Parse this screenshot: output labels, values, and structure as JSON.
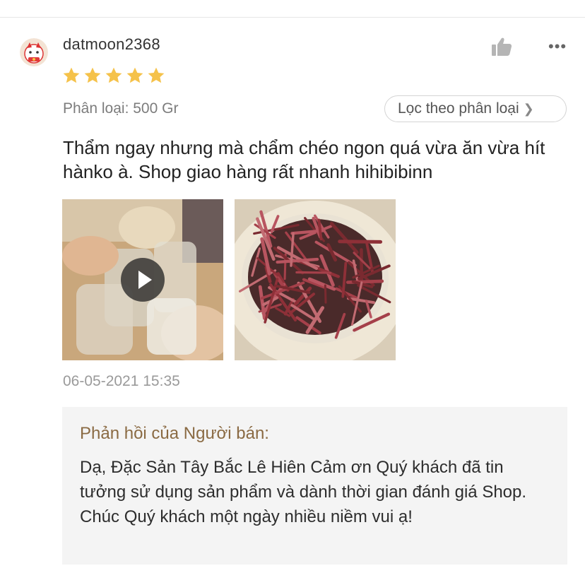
{
  "review": {
    "username": "datmoon2368",
    "rating": 5,
    "variant": "Phân loại: 500 Gr",
    "filter_button": "Lọc theo phân loại",
    "text": "Thẩm ngay nhưng mà chẩm chéo ngon quá vừa ăn vừa hít hànko à. Shop giao hàng rất nhanh hihibibinn",
    "timestamp": "06-05-2021 15:35",
    "media": [
      {
        "type": "video",
        "icon": "play-icon"
      },
      {
        "type": "photo"
      }
    ]
  },
  "seller_reply": {
    "title": "Phản hồi của Người bán:",
    "text": "Dạ, Đặc Sản Tây Bắc Lê Hiên Cảm ơn Quý khách đã tin tưởng sử dụng sản phẩm và dành thời gian đánh giá Shop. Chúc Quý khách một ngày nhiều niềm vui ạ!"
  },
  "colors": {
    "star": "#f5c24a",
    "seller_title": "#8a6a43",
    "seller_bg": "#f4f4f4"
  },
  "icons": {
    "like": "thumbs-up-icon",
    "more": "more-dots-icon",
    "chevron": "chevron-right-icon"
  }
}
